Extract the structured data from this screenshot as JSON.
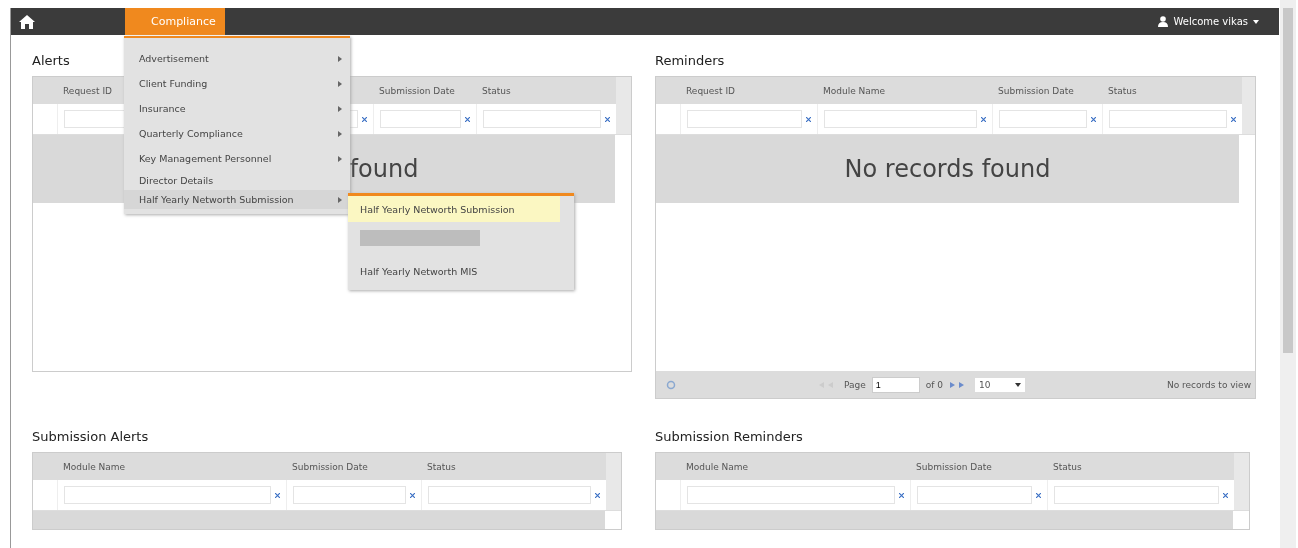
{
  "navbar": {
    "menu_label": "Compliance",
    "user_label": "Welcome vikas"
  },
  "menu": {
    "items": [
      {
        "label": "Advertisement",
        "has_submenu": true,
        "expanded": false
      },
      {
        "label": "Client Funding",
        "has_submenu": true,
        "expanded": false
      },
      {
        "label": "Insurance",
        "has_submenu": true,
        "expanded": false
      },
      {
        "label": "Quarterly Compliance",
        "has_submenu": true,
        "expanded": false
      },
      {
        "label": "Key Management Personnel",
        "has_submenu": true,
        "expanded": false
      },
      {
        "label": "Director Details",
        "has_submenu": false,
        "expanded": false
      },
      {
        "label": "Half Yearly Networth Submission",
        "has_submenu": true,
        "expanded": true
      }
    ]
  },
  "submenu": {
    "items": [
      {
        "kind": "item",
        "label": "Half Yearly Networth Submission",
        "selected": true
      },
      {
        "kind": "redacted"
      },
      {
        "kind": "item",
        "label": "Half Yearly Networth MIS",
        "selected": false
      }
    ]
  },
  "panels": [
    {
      "title": "Alerts",
      "columns": [
        {
          "label": "Request ID"
        },
        {},
        {
          "label": "Submission Date"
        },
        {
          "label": "Status"
        }
      ],
      "empty_message": "found"
    },
    {
      "title": "Reminders",
      "columns": [
        {
          "label": "Request ID"
        },
        {
          "label": "Module Name"
        },
        {
          "label": "Submission Date"
        },
        {
          "label": "Status"
        }
      ],
      "empty_message": "No records found",
      "pager": {
        "page_label": "Page",
        "page_value": "1",
        "of_label": "of 0",
        "page_size": "10",
        "records_text": "No records to view"
      }
    },
    {
      "title": "Submission Alerts",
      "columns": [
        {
          "label": "Module Name"
        },
        {
          "label": "Submission Date"
        },
        {
          "label": "Status"
        }
      ]
    },
    {
      "title": "Submission Reminders",
      "columns": [
        {
          "label": "Module Name"
        },
        {
          "label": "Submission Date"
        },
        {
          "label": "Status"
        }
      ]
    }
  ]
}
